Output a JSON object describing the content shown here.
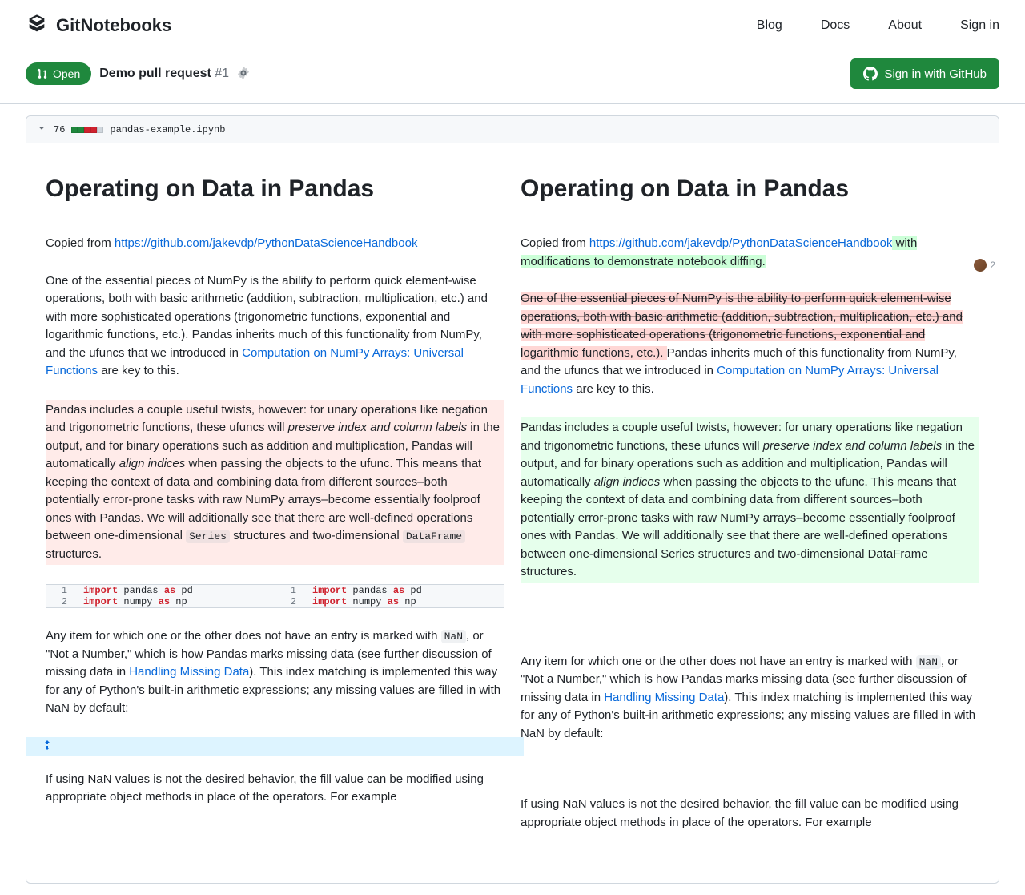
{
  "brand": "GitNotebooks",
  "nav": {
    "blog": "Blog",
    "docs": "Docs",
    "about": "About",
    "signin": "Sign in"
  },
  "pr": {
    "open": "Open",
    "title": "Demo pull request",
    "number": "#1",
    "signin_github": "Sign in with GitHub"
  },
  "file": {
    "diff_count": "76",
    "name": "pandas-example.ipynb"
  },
  "h1": "Operating on Data in Pandas",
  "copied_prefix": "Copied from ",
  "handbook_url": "https://github.com/jakevdp/PythonDataScienceHandbook",
  "added_suffix": " with modifications to demonstrate notebook diffing.",
  "p2_a": "One of the essential pieces of NumPy is the ability to perform quick element-wise operations, both with basic arithmetic (addition, subtraction, multiplication, etc.) and with more sophisticated operations (trigonometric functions, exponential and logarithmic functions, etc.). ",
  "p2_b": "Pandas inherits much of this functionality from NumPy, and the ufuncs that we introduced in ",
  "p2_link": "Computation on NumPy Arrays: Universal Functions",
  "p2_c": " are key to this.",
  "p3_a": "Pandas includes a couple useful twists, however: for unary operations like negation and trigonometric functions, these ufuncs will ",
  "p3_i1": "preserve index and column labels",
  "p3_b": " in the output, and for binary operations such as addition and multiplication, Pandas will automatically ",
  "p3_i2": "align indices",
  "p3_c": " when passing the objects to the ufunc. This means that keeping the context of data and combining data from different sources–both potentially error-prone tasks with raw NumPy arrays–become essentially foolproof ones with Pandas. We will additionally see that there are well-defined operations between one-dimensional ",
  "p3_series_l": "Series",
  "p3_d": " structures and two-dimensional ",
  "p3_df_l": "DataFrame",
  "p3_e": " structures.",
  "p3_right_tail": "Series structures and two-dimensional DataFrame structures.",
  "code": {
    "ln1": "1",
    "ln2": "2",
    "kw_import": "import",
    "kw_as": "as",
    "pandas": " pandas ",
    "pd": " pd",
    "numpy": " numpy ",
    "np": " np"
  },
  "p4_a": "Any item for which one or the other does not have an entry is marked with ",
  "p4_nan": "NaN",
  "p4_b": ", or \"Not a Number,\" which is how Pandas marks missing data (see further discussion of missing data in ",
  "p4_link": "Handling Missing Data",
  "p4_c": "). This index matching is implemented this way for any of Python's built-in arithmetic expressions; any missing values are filled in with NaN by default:",
  "p5": "If using NaN values is not the desired behavior, the fill value can be modified using appropriate object methods in place of the operators. For example",
  "annot_count": "2"
}
